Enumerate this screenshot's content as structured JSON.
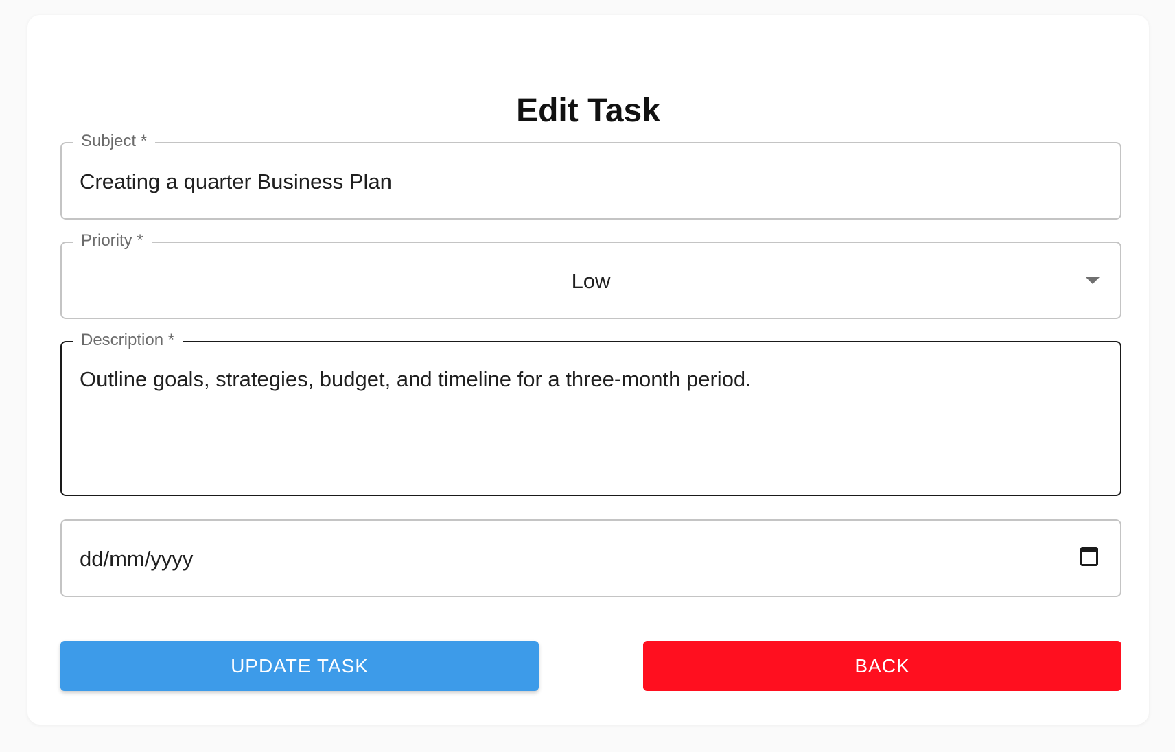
{
  "form": {
    "title": "Edit Task",
    "subject": {
      "label": "Subject *",
      "value": "Creating a quarter Business Plan"
    },
    "priority": {
      "label": "Priority *",
      "value": "Low"
    },
    "description": {
      "label": "Description *",
      "value": "Outline goals, strategies, budget, and timeline for a three-month period."
    },
    "date": {
      "placeholder": "dd/mm/yyyy"
    }
  },
  "buttons": {
    "update_label": "UPDATE TASK",
    "back_label": "BACK"
  },
  "colors": {
    "update_button": "#3d9be9",
    "back_button": "#ff0f1f",
    "focused_border": "#1a1a1a",
    "border": "#c4c4c4"
  },
  "icons": [
    "chevron-down-icon",
    "calendar-icon"
  ]
}
